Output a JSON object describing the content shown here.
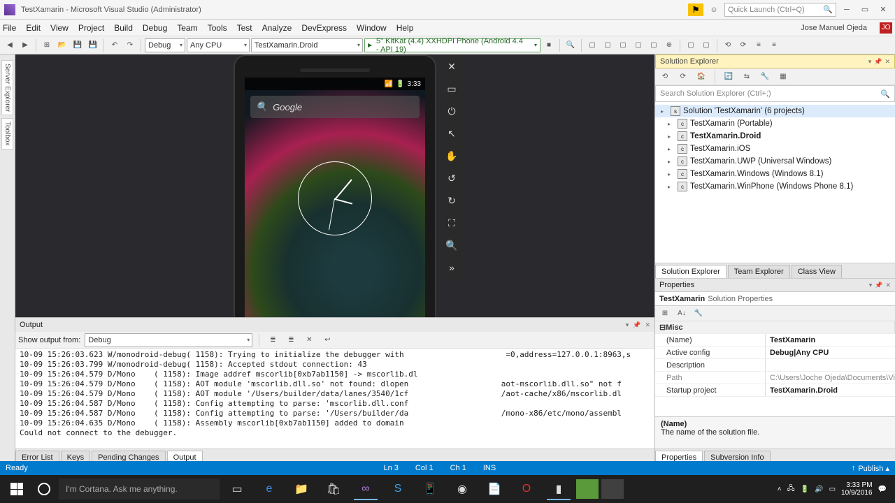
{
  "titlebar": {
    "title": "TestXamarin - Microsoft Visual Studio  (Administrator)",
    "quick_launch_placeholder": "Quick Launch (Ctrl+Q)"
  },
  "menubar": {
    "items": [
      "File",
      "Edit",
      "View",
      "Project",
      "Build",
      "Debug",
      "Team",
      "Tools",
      "Test",
      "Analyze",
      "DevExpress",
      "Window",
      "Help"
    ],
    "user": "Jose Manuel Ojeda",
    "user_initials": "JO"
  },
  "toolbar": {
    "config": "Debug",
    "platform": "Any CPU",
    "startup": "TestXamarin.Droid",
    "device": "5\" KitKat (4.4) XXHDPI Phone (Android 4.4 - API 19)"
  },
  "side_tabs": [
    "Server Explorer",
    "Toolbox"
  ],
  "emulator": {
    "time": "3:33",
    "search_placeholder": "Google"
  },
  "solution_explorer": {
    "title": "Solution Explorer",
    "search_placeholder": "Search Solution Explorer (Ctrl+;)",
    "solution": "Solution 'TestXamarin' (6 projects)",
    "projects": [
      "TestXamarin (Portable)",
      "TestXamarin.Droid",
      "TestXamarin.iOS",
      "TestXamarin.UWP (Universal Windows)",
      "TestXamarin.Windows (Windows 8.1)",
      "TestXamarin.WinPhone (Windows Phone 8.1)"
    ],
    "tabs": [
      "Solution Explorer",
      "Team Explorer",
      "Class View"
    ]
  },
  "properties": {
    "title": "Properties",
    "header_name": "TestXamarin",
    "header_type": "Solution Properties",
    "category": "Misc",
    "rows": [
      {
        "k": "(Name)",
        "v": "TestXamarin"
      },
      {
        "k": "Active config",
        "v": "Debug|Any CPU"
      },
      {
        "k": "Description",
        "v": ""
      },
      {
        "k": "Path",
        "v": "C:\\Users\\Joche Ojeda\\Documents\\Vi",
        "gray": true
      },
      {
        "k": "Startup project",
        "v": "TestXamarin.Droid"
      }
    ],
    "desc_name": "(Name)",
    "desc_text": "The name of the solution file.",
    "tabs": [
      "Properties",
      "Subversion Info"
    ]
  },
  "output": {
    "title": "Output",
    "from_label": "Show output from:",
    "from_value": "Debug",
    "lines": [
      "10-09 15:26:03.623 W/monodroid-debug( 1158): Trying to initialize the debugger with                      =0,address=127.0.0.1:8963,s",
      "10-09 15:26:03.799 W/monodroid-debug( 1158): Accepted stdout connection: 43",
      "10-09 15:26:04.579 D/Mono    ( 1158): Image addref mscorlib[0xb7ab1150] -> mscorlib.dl",
      "10-09 15:26:04.579 D/Mono    ( 1158): AOT module 'mscorlib.dll.so' not found: dlopen                    aot-mscorlib.dll.so\" not f",
      "10-09 15:26:04.579 D/Mono    ( 1158): AOT module '/Users/builder/data/lanes/3540/1cf                    /aot-cache/x86/mscorlib.dl",
      "10-09 15:26:04.587 D/Mono    ( 1158): Config attempting to parse: 'mscorlib.dll.conf",
      "10-09 15:26:04.587 D/Mono    ( 1158): Config attempting to parse: '/Users/builder/da                    /mono-x86/etc/mono/assembl",
      "10-09 15:26:04.635 D/Mono    ( 1158): Assembly mscorlib[0xb7ab1150] added to domain",
      "Could not connect to the debugger."
    ],
    "tabs": [
      "Error List",
      "Keys",
      "Pending Changes",
      "Output"
    ]
  },
  "statusbar": {
    "ready": "Ready",
    "ln": "Ln 3",
    "col": "Col 1",
    "ch": "Ch 1",
    "ins": "INS",
    "publish": "Publish ▴"
  },
  "taskbar": {
    "cortana": "I'm Cortana. Ask me anything.",
    "time": "3:33 PM",
    "date": "10/9/2016"
  }
}
